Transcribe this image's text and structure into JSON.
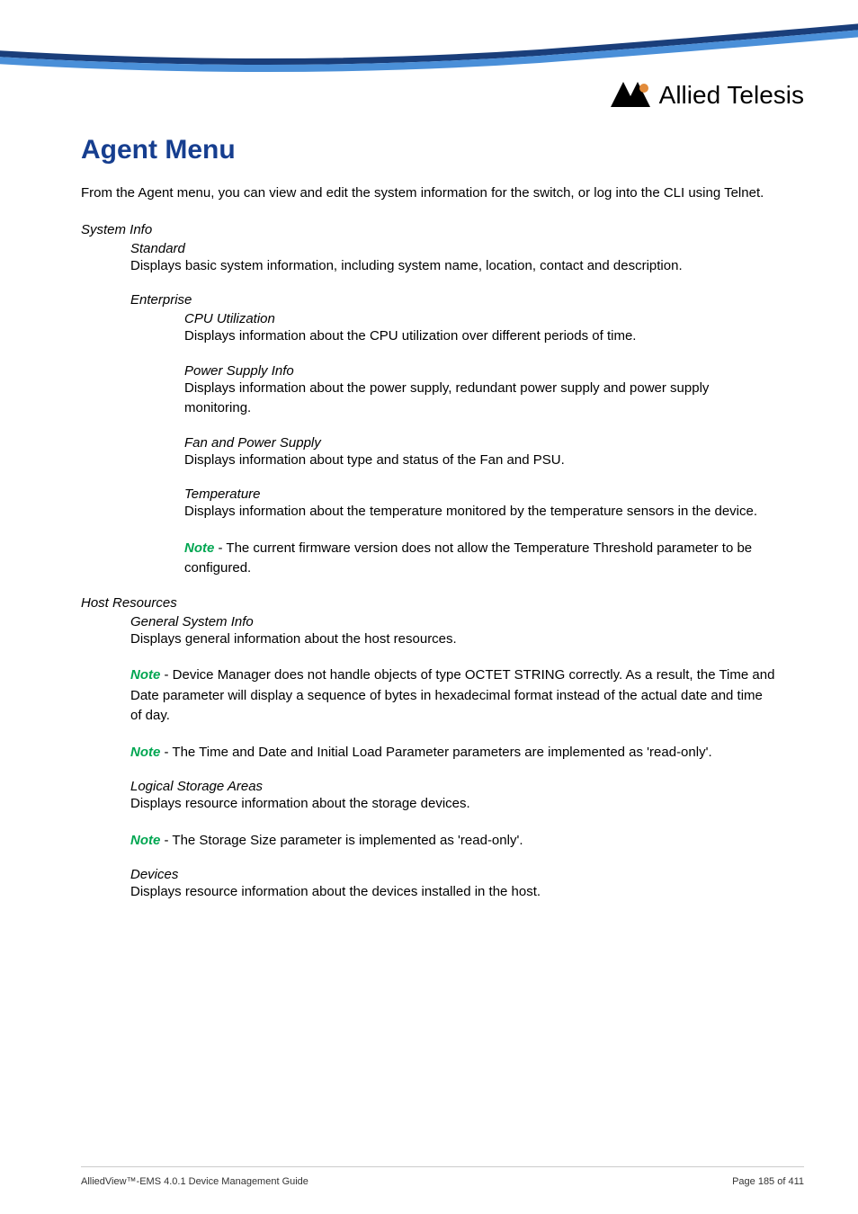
{
  "logo": {
    "brand": "Allied Telesis"
  },
  "title": "Agent Menu",
  "intro": "From the Agent menu, you can view and edit the system information for the switch, or log into the CLI using Telnet.",
  "systemInfo": {
    "heading": "System Info",
    "standard": {
      "title": "Standard",
      "text": "Displays basic system information, including system name, location, contact and description."
    },
    "enterprise": {
      "title": "Enterprise",
      "cpuUtil": {
        "title": "CPU Utilization",
        "text": "Displays information about the CPU utilization over different periods of time."
      },
      "powerSupply": {
        "title": "Power Supply Info",
        "text": "Displays information about the power supply, redundant power supply and power supply monitoring."
      },
      "fanPower": {
        "title": "Fan and Power Supply",
        "text": "Displays information about type and status of the Fan and PSU."
      },
      "temperature": {
        "title": "Temperature",
        "text": "Displays information about the temperature monitored by the temperature sensors in the device.",
        "noteLabel": "Note",
        "noteText": " - The current firmware version does not allow the Temperature Threshold parameter to be configured."
      }
    }
  },
  "hostResources": {
    "heading": "Host Resources",
    "generalSystem": {
      "title": "General System Info",
      "text": "Displays general information about the host resources.",
      "note1Label": "Note",
      "note1Text": " - Device Manager does not handle objects of type OCTET STRING correctly. As a result, the Time and Date parameter will display a sequence of bytes in hexadecimal format instead of the actual date and time of day.",
      "note2Label": "Note",
      "note2Text": " - The Time and Date and Initial Load Parameter parameters are implemented as 'read-only'."
    },
    "logicalStorage": {
      "title": "Logical Storage Areas",
      "text": "Displays resource information about the storage devices.",
      "noteLabel": "Note",
      "noteText": " - The Storage Size parameter is implemented as 'read-only'."
    },
    "devices": {
      "title": "Devices",
      "text": "Displays resource information about the devices installed in the host."
    }
  },
  "footer": {
    "left": "AlliedView™-EMS 4.0.1 Device Management Guide",
    "right": "Page 185 of 411"
  }
}
